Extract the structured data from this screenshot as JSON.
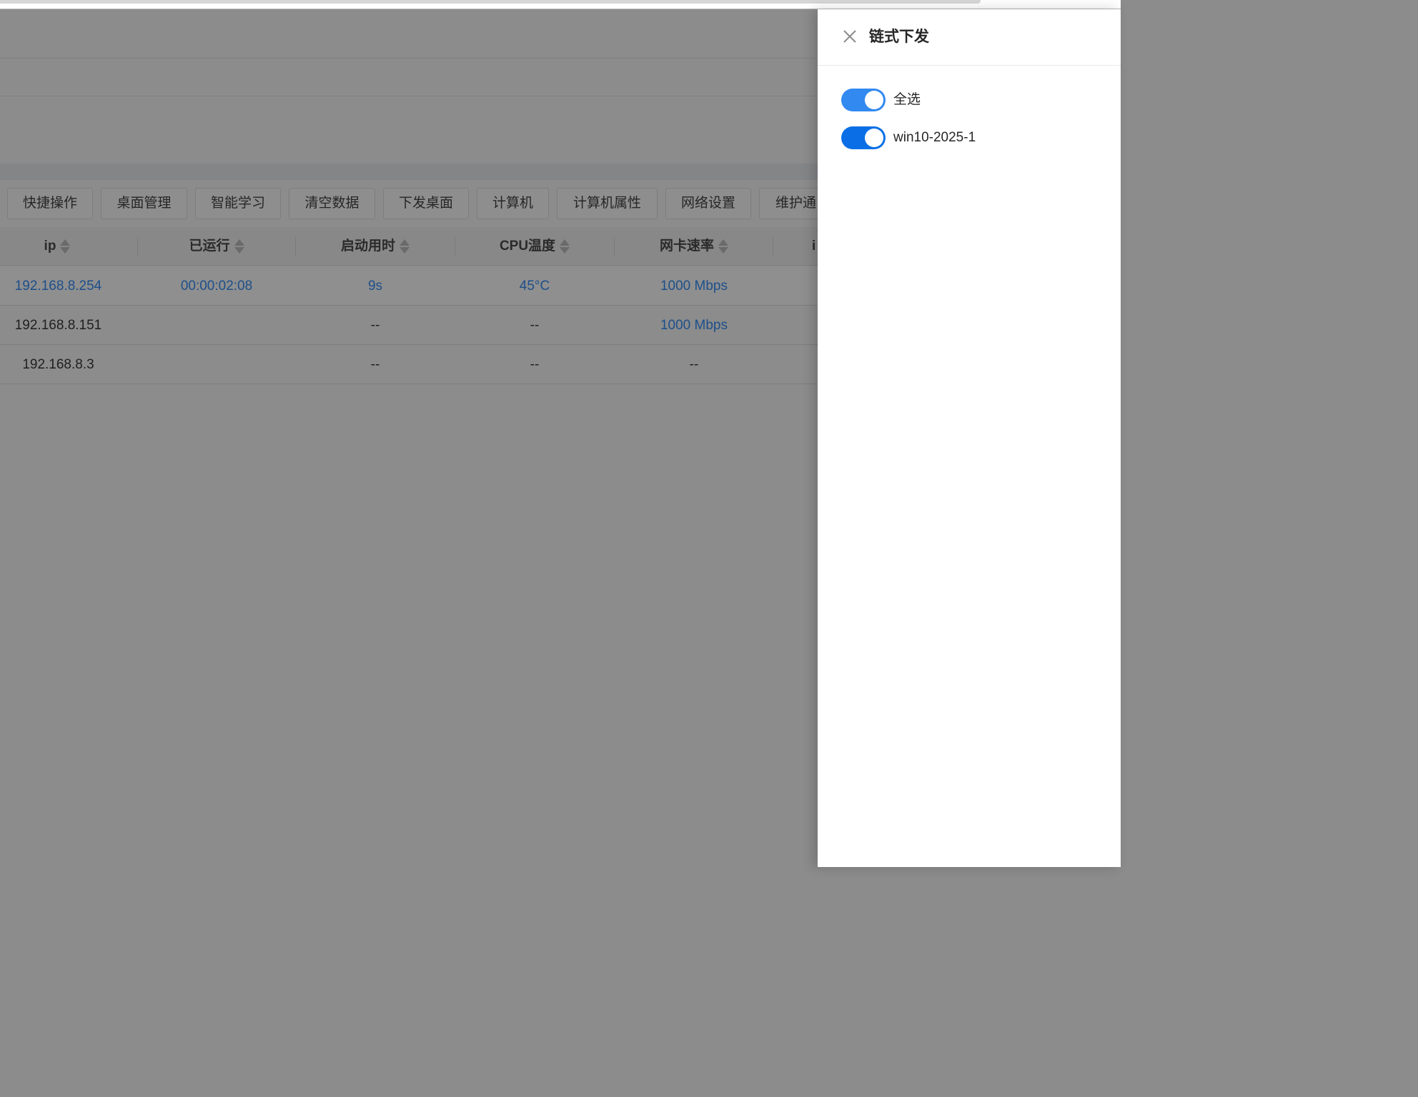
{
  "colors": {
    "switch_all": "#3289f0",
    "switch_item": "#0a6fe6",
    "link_blue": "#1d4f8a"
  },
  "toolbar": {
    "buttons": [
      "快捷操作",
      "桌面管理",
      "智能学习",
      "清空数据",
      "下发桌面",
      "计算机",
      "计算机属性",
      "网络设置",
      "维护通"
    ]
  },
  "table": {
    "columns": [
      "ip",
      "已运行",
      "启动用时",
      "CPU温度",
      "网卡速率",
      "i"
    ],
    "rows": [
      {
        "ip": "192.168.8.254",
        "uptime": "00:00:02:08",
        "boot_time": "9s",
        "cpu_temp": "45°C",
        "nic_speed": "1000 Mbps"
      },
      {
        "ip": "192.168.8.151",
        "uptime": "",
        "boot_time": "--",
        "cpu_temp": "--",
        "nic_speed": "1000 Mbps"
      },
      {
        "ip": "192.168.8.3",
        "uptime": "",
        "boot_time": "--",
        "cpu_temp": "--",
        "nic_speed": "--"
      }
    ]
  },
  "drawer": {
    "title": "链式下发",
    "close_icon": "close-icon",
    "options": [
      {
        "label": "全选",
        "checked": true
      },
      {
        "label": "win10-2025-1",
        "checked": true
      }
    ]
  }
}
